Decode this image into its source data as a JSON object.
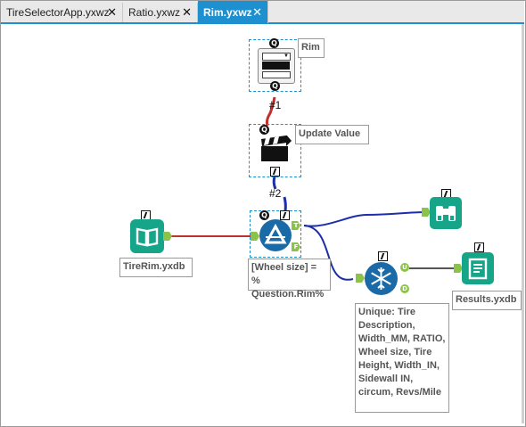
{
  "tabs": [
    {
      "label": "TireSelectorApp.yxwz",
      "close": "✕",
      "active": false
    },
    {
      "label": "Ratio.yxwz",
      "close": "✕",
      "active": false
    },
    {
      "label": "Rim.yxwz",
      "close": "✕",
      "active": true
    }
  ],
  "canvas": {
    "rim_tool": {
      "annotation": "Rim",
      "icon": "dropdown-icon"
    },
    "update_value_tool": {
      "annotation": "Update Value",
      "icon": "clapperboard-icon"
    },
    "connection_1_label": "#1",
    "connection_2_label": "#2",
    "filter_tool": {
      "annotation": "[Wheel size] = %\nQuestion.Rim%",
      "icon": "filter-icon",
      "true_port": "T",
      "false_port": "F"
    },
    "input_tool": {
      "annotation": "TireRim.yxdb",
      "icon": "book-icon"
    },
    "browse_tool": {
      "icon": "binoculars-icon"
    },
    "unique_tool": {
      "annotation": "Unique: Tire Description, Width_MM, RATIO, Wheel size, Tire Height, Width_IN, Sidewall IN, circum, Revs/Mile",
      "icon": "snowflake-icon",
      "unique_port": "U",
      "duplicate_port": "D"
    },
    "output_tool": {
      "annotation": "Results.yxdb",
      "icon": "output-icon"
    }
  },
  "anchors": {
    "question": "Q",
    "lightning": "⚡"
  },
  "colors": {
    "tab_active": "#1e90d0",
    "connection_red": "#c0302e",
    "connection_blue": "#1c2fa8",
    "tool_teal": "#17a589",
    "tool_blue": "#1a6aa8"
  }
}
